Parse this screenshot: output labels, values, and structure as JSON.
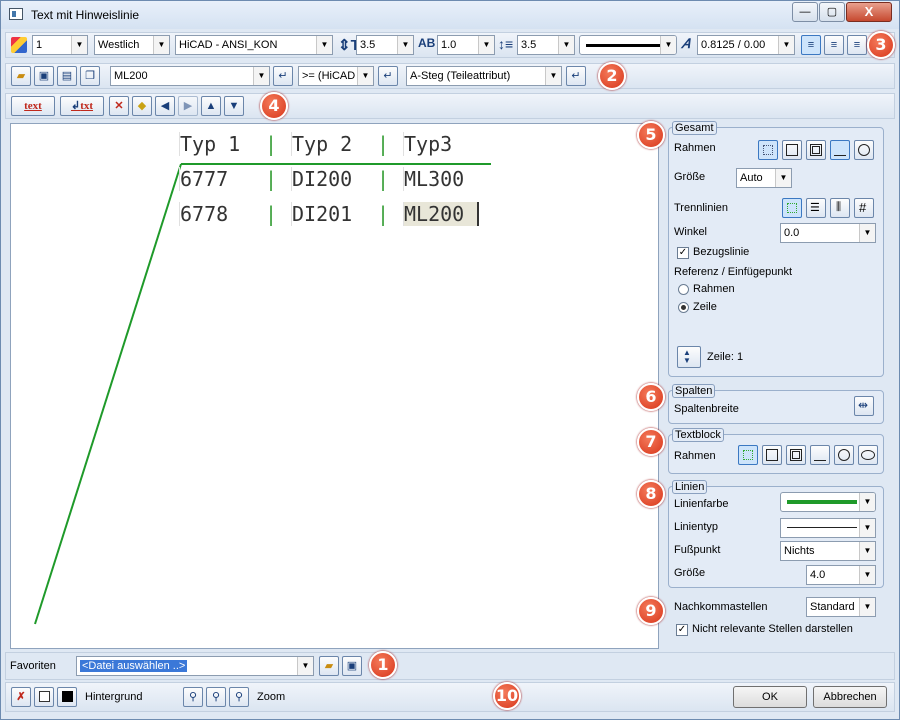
{
  "window": {
    "title": "Text mit Hinweislinie",
    "minimize": "—",
    "maximize": "▢",
    "close": "X"
  },
  "toolbar1": {
    "layer": "1",
    "style": "Westlich",
    "font": "HiCAD - ANSI_KON",
    "text_height": "3.5",
    "char_width": "1.0",
    "line_spacing": "3.5",
    "slant": "0.8125 / 0.00",
    "badge": "3"
  },
  "toolbar2": {
    "attr_name": "ML200",
    "compare": ">= (HiCAD",
    "attr_type": "A-Steg (Teileattribut)",
    "badge": "2"
  },
  "toolbar3": {
    "text_button": "text",
    "txt_button": "txt",
    "badge": "4"
  },
  "table": {
    "headers": [
      "Typ 1",
      "Typ 2",
      "Typ3"
    ],
    "rows": [
      [
        "6777",
        "DI200",
        "ML300"
      ],
      [
        "6778",
        "DI201",
        "ML200"
      ]
    ],
    "separator": "|"
  },
  "gesamt": {
    "legend": "Gesamt",
    "badge": "5",
    "rahmen": "Rahmen",
    "groesse": "Größe",
    "groesse_value": "Auto",
    "trennlinien": "Trennlinien",
    "winkel": "Winkel",
    "winkel_value": "0.0",
    "bezugslinie": "Bezugslinie",
    "referenz": "Referenz / Einfügepunkt",
    "opt_rahmen": "Rahmen",
    "opt_zeile": "Zeile",
    "zeile": "Zeile: 1"
  },
  "spalten": {
    "legend": "Spalten",
    "badge": "6",
    "spaltenbreite": "Spaltenbreite"
  },
  "textblock": {
    "legend": "Textblock",
    "badge": "7",
    "rahmen": "Rahmen"
  },
  "linien": {
    "legend": "Linien",
    "badge": "8",
    "linienfarbe": "Linienfarbe",
    "linientyp": "Linientyp",
    "fusspunkt": "Fußpunkt",
    "fusspunkt_value": "Nichts",
    "groesse": "Größe",
    "groesse_value": "4.0",
    "color": "#1f9a2a"
  },
  "nachkomma": {
    "label": "Nachkommastellen",
    "value": "Standard",
    "badge": "9",
    "nicht_relevant": "Nicht relevante Stellen darstellen"
  },
  "favoriten": {
    "label": "Favoriten",
    "placeholder": "<Datei auswählen ..>",
    "badge": "1"
  },
  "bottom": {
    "hintergrund": "Hintergrund",
    "zoom": "Zoom",
    "ok": "OK",
    "abbrechen": "Abbrechen",
    "badge": "10"
  }
}
